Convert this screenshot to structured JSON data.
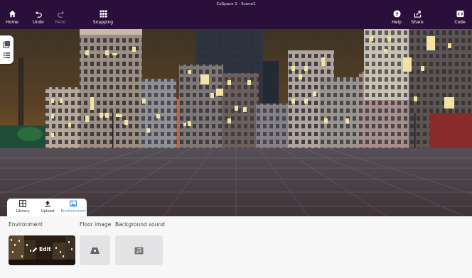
{
  "window": {
    "title": "CoSpace 1 - Scene1"
  },
  "toolbar": {
    "left": [
      {
        "label": "Home",
        "icon": "home-icon"
      },
      {
        "label": "Undo",
        "icon": "undo-icon"
      },
      {
        "label": "Redo",
        "icon": "redo-icon",
        "disabled": true
      },
      {
        "label": "Snapping",
        "icon": "grid-icon"
      }
    ],
    "right": [
      {
        "label": "Help",
        "icon": "help-icon"
      },
      {
        "label": "Share",
        "icon": "share-icon"
      },
      {
        "label": "Code",
        "icon": "code-icon"
      }
    ]
  },
  "side_panel": {
    "icons": [
      "layers-icon",
      "list-icon"
    ]
  },
  "bottom_tabs": [
    {
      "label": "Library",
      "icon": "library-icon"
    },
    {
      "label": "Upload",
      "icon": "upload-icon"
    },
    {
      "label": "Environment",
      "icon": "image-icon",
      "active": true
    }
  ],
  "sections": {
    "environment_label": "Environment",
    "floor_label": "Floor image",
    "sound_label": "Background sound"
  },
  "environment": {
    "edit_label": "Edit"
  },
  "colors": {
    "toolbar_bg": "#2a0f3a",
    "accent": "#3c8ee0",
    "panel_bg": "#f7f7f8",
    "slot_bg": "#e3e3e6",
    "window_light": "#f4e3a0"
  }
}
